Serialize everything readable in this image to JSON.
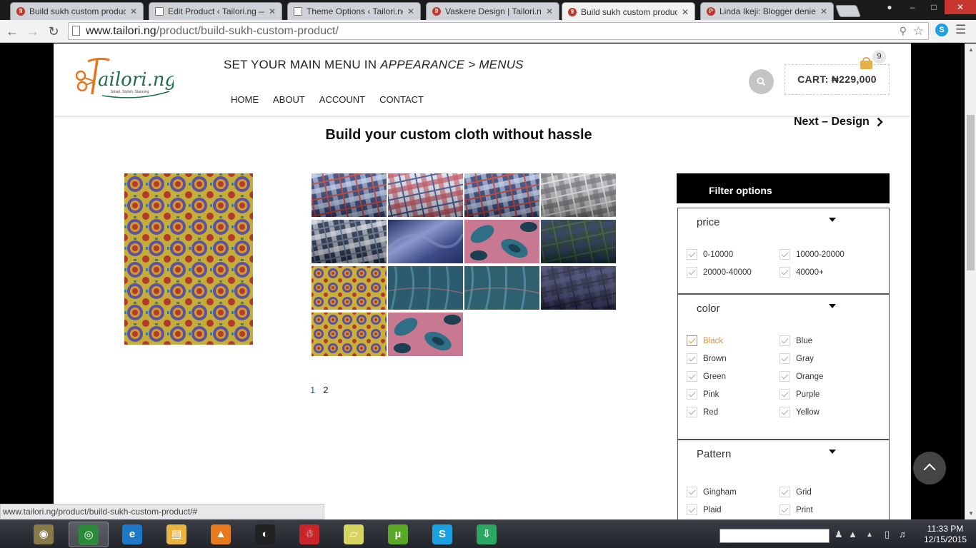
{
  "browser": {
    "tabs": [
      {
        "title": "Build sukh custom produc",
        "favicon": "tailori-icon",
        "active": false
      },
      {
        "title": "Edit Product ‹ Tailori.ng —",
        "favicon": "document-icon",
        "active": false
      },
      {
        "title": "Theme Options ‹ Tailori.ng",
        "favicon": "document-icon",
        "active": false
      },
      {
        "title": "Vaskere Design | Tailori.ng",
        "favicon": "tailori-icon",
        "active": false
      },
      {
        "title": "Build sukh custom produc",
        "favicon": "tailori-icon",
        "active": true
      },
      {
        "title": "Linda Ikeji: Blogger denies",
        "favicon": "blogger-icon",
        "active": false
      }
    ],
    "url_host": "www.tailori.ng",
    "url_path": "/product/build-sukh-custom-product/",
    "status_url": "www.tailori.ng/product/build-sukh-custom-product/#"
  },
  "header": {
    "menu_notice_prefix": "SET YOUR MAIN MENU IN ",
    "menu_notice_em": "APPEARANCE > MENUS",
    "nav": [
      "HOME",
      "ABOUT",
      "ACCOUNT",
      "CONTACT"
    ],
    "cart_label": "CART: ₦229,000",
    "cart_count": "9",
    "logo_tagline": "Smart. Stylish. Stunning"
  },
  "main": {
    "next_link": "Next – Design",
    "heading": "Build your custom cloth without hassle",
    "pages": [
      "1",
      "2"
    ],
    "swatches": [
      {
        "name": "plaid-blue-red",
        "pattern": "plaid",
        "c1": "#2a3f7a",
        "c2": "#c8d4ee",
        "c3": "#c0392b"
      },
      {
        "name": "plaid-red-white",
        "pattern": "plaid",
        "c1": "#d9dde8",
        "c2": "#c0414f",
        "c3": "#3a4a8c"
      },
      {
        "name": "plaid-blue-red-2",
        "pattern": "plaid",
        "c1": "#2a3f7a",
        "c2": "#c8d4ee",
        "c3": "#c0392b"
      },
      {
        "name": "plaid-gray",
        "pattern": "plaid",
        "c1": "#b9b9bd",
        "c2": "#6b6b70",
        "c3": "#e5e5e8"
      },
      {
        "name": "plaid-navy-white",
        "pattern": "plaid",
        "c1": "#1d2a44",
        "c2": "#dfe3ea",
        "c3": "#5a6a8a"
      },
      {
        "name": "satin-blue",
        "pattern": "satin",
        "c1": "#3c4a86",
        "c2": "#8a98cc",
        "c3": "#232f62"
      },
      {
        "name": "paisley-teal",
        "pattern": "paisley",
        "c1": "#c87891",
        "c2": "#2f6f86",
        "c3": "#1c3f52"
      },
      {
        "name": "tartan-green",
        "pattern": "plaid",
        "c1": "#123024",
        "c2": "#1a2a55",
        "c3": "#2e4a3a"
      },
      {
        "name": "ankara-yellow",
        "pattern": "ankara",
        "c1": "#c9b03a",
        "c2": "#5a4fa0",
        "c3": "#b3392c"
      },
      {
        "name": "lace-teal",
        "pattern": "lace",
        "c1": "#2c5a6e",
        "c2": "#4a8296",
        "c3": "#a0707a"
      },
      {
        "name": "lace-teal-2",
        "pattern": "lace",
        "c1": "#2f6070",
        "c2": "#4d8799",
        "c3": "#a87680"
      },
      {
        "name": "gingham-navy",
        "pattern": "plaid",
        "c1": "#1f2544",
        "c2": "#3a4070",
        "c3": "#14182e"
      },
      {
        "name": "ankara-yellow-2",
        "pattern": "ankara",
        "c1": "#c9b03a",
        "c2": "#5a4fa0",
        "c3": "#b3392c"
      },
      {
        "name": "paisley-teal-2",
        "pattern": "paisley",
        "c1": "#c87891",
        "c2": "#2f6f86",
        "c3": "#1c3f52"
      }
    ]
  },
  "filters": {
    "title": "Filter options",
    "groups": [
      {
        "title": "price",
        "options": [
          {
            "label": "0-10000",
            "selected": false
          },
          {
            "label": "10000-20000",
            "selected": false
          },
          {
            "label": "20000-40000",
            "selected": false
          },
          {
            "label": "40000+",
            "selected": false
          }
        ]
      },
      {
        "title": "color",
        "options": [
          {
            "label": "Black",
            "selected": true
          },
          {
            "label": "Blue",
            "selected": false
          },
          {
            "label": "Brown",
            "selected": false
          },
          {
            "label": "Gray",
            "selected": false
          },
          {
            "label": "Green",
            "selected": false
          },
          {
            "label": "Orange",
            "selected": false
          },
          {
            "label": "Pink",
            "selected": false
          },
          {
            "label": "Purple",
            "selected": false
          },
          {
            "label": "Red",
            "selected": false
          },
          {
            "label": "Yellow",
            "selected": false
          }
        ]
      },
      {
        "title": "Pattern",
        "options": [
          {
            "label": "Gingham",
            "selected": false
          },
          {
            "label": "Grid",
            "selected": false
          },
          {
            "label": "Plaid",
            "selected": false
          },
          {
            "label": "Print",
            "selected": false
          }
        ]
      }
    ]
  },
  "taskbar": {
    "apps": [
      "system-icon",
      "chrome-icon",
      "ie-icon",
      "explorer-icon",
      "vlc-icon",
      "media-icon",
      "game-icon",
      "sticky-notes-icon",
      "utorrent-icon",
      "skype-icon",
      "download-icon"
    ],
    "time": "11:33 PM",
    "date": "12/15/2015"
  },
  "colors": {
    "accent": "#e2962b",
    "link": "#2d5fa6",
    "filter_header": "#000000"
  }
}
